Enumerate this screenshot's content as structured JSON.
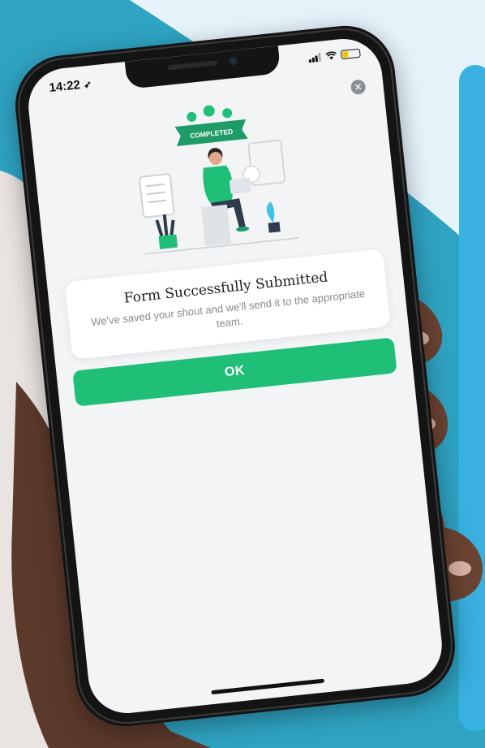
{
  "status_bar": {
    "time": "14:22",
    "icons": [
      "location-arrow-icon",
      "signal-icon",
      "wifi-icon",
      "battery-icon"
    ]
  },
  "close_icon": "close-icon",
  "illustration": {
    "banner_text": "COMPLETED"
  },
  "dialog": {
    "title": "Form Successfully Submitted",
    "message": "We've saved your shout and we'll send it to the appropriate team."
  },
  "ok_button": {
    "label": "OK"
  },
  "colors": {
    "primary_green": "#1fbf78",
    "background_light": "#e6f3fb",
    "background_teal": "#2fa3c2",
    "screen_bg": "#f2f4f5",
    "panel_blue": "#39b0e0"
  }
}
